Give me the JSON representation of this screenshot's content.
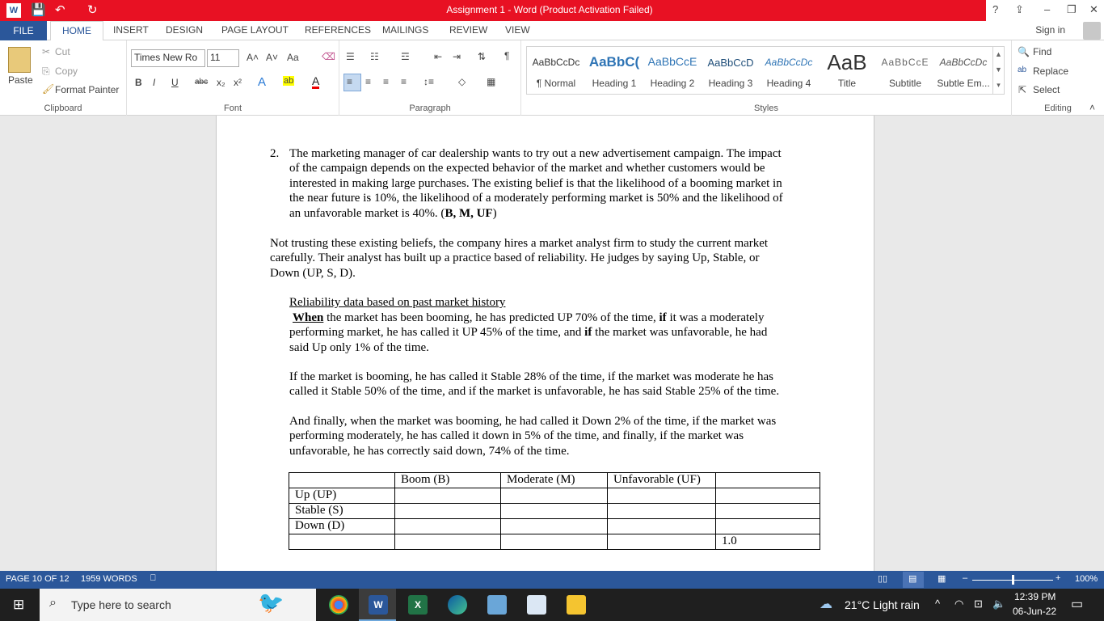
{
  "window": {
    "title": "Assignment 1  -  Word (Product Activation Failed)"
  },
  "title_controls": {
    "help": "?",
    "ribbon_options": "⇪",
    "minimize": "–",
    "restore": "❐",
    "close": "✕"
  },
  "tabs": {
    "file": "FILE",
    "items": [
      "HOME",
      "INSERT",
      "DESIGN",
      "PAGE LAYOUT",
      "REFERENCES",
      "MAILINGS",
      "REVIEW",
      "VIEW"
    ],
    "sign_in": "Sign in"
  },
  "ribbon": {
    "clipboard": {
      "paste": "Paste",
      "cut": "Cut",
      "copy": "Copy",
      "format_painter": "Format Painter",
      "label": "Clipboard"
    },
    "font": {
      "name": "Times New Ro",
      "size": "11",
      "grow": "A˄",
      "shrink": "A˅",
      "case": "Aa",
      "bold": "B",
      "italic": "I",
      "underline": "U",
      "strike": "abc",
      "subscript": "x₂",
      "superscript": "x²",
      "label": "Font"
    },
    "paragraph": {
      "label": "Paragraph"
    },
    "styles": {
      "items": [
        {
          "preview": "AaBbCcDc",
          "name": "¶ Normal"
        },
        {
          "preview": "AaBbC(",
          "name": "Heading 1"
        },
        {
          "preview": "AaBbCcE",
          "name": "Heading 2"
        },
        {
          "preview": "AaBbCcD",
          "name": "Heading 3"
        },
        {
          "preview": "AaBbCcDc",
          "name": "Heading 4"
        },
        {
          "preview": "AaB",
          "name": "Title"
        },
        {
          "preview": "AaBbCcE",
          "name": "Subtitle"
        },
        {
          "preview": "AaBbCcDc",
          "name": "Subtle Em..."
        }
      ],
      "label": "Styles"
    },
    "editing": {
      "find": "Find",
      "replace": "Replace",
      "select": "Select",
      "label": "Editing"
    }
  },
  "document": {
    "q2_number": "2.",
    "q2_lines": [
      "The marketing manager of car dealership wants to try out a new advertisement campaign.   The impact",
      "of the campaign depends on the expected behavior of the market and whether customers would be",
      "interested in making large purchases. The existing belief is that the likelihood of a booming market in",
      "the near future is 10%, the likelihood of a moderately performing market is 50% and the likelihood of",
      "an unfavorable market is 40%. ("
    ],
    "q2_bold_tail": "B, M, UF",
    "q2_close": ")",
    "trust_lines": [
      "Not trusting these existing beliefs, the company hires a market analyst firm to study the current market",
      "carefully. Their analyst has built up a practice based of reliability. He judges by saying Up, Stable, or",
      "Down (UP, S, D)."
    ],
    "reliability_heading": "Reliability data based on past market history",
    "up_when": "When",
    "up_line1_a": " the market has been booming, he has predicted UP 70% of the time, ",
    "up_if": "if",
    "up_line1_b": " it was a moderately",
    "up_line2_a": "performing market,  he has called it UP 45% of the time, and ",
    "up_if2": "if",
    "up_line2_b": " the market was unfavorable, he had",
    "up_line3": "said Up only 1% of the time.",
    "stable_lines": [
      "If the market is booming, he has called it Stable 28% of the time, if the market was moderate he has",
      "called it Stable 50% of the time, and if the market is unfavorable, he has said Stable 25% of the time."
    ],
    "down_lines": [
      "And finally, when the market was booming,  he had called it Down 2% of the time, if the market was",
      "performing moderately, he has called it down in 5% of the time, and finally, if the market was",
      "unfavorable, he has correctly said down, 74% of the time."
    ],
    "table": {
      "header": [
        "",
        "Boom (B)",
        "Moderate (M)",
        "Unfavorable (UF)",
        ""
      ],
      "rows": [
        [
          "Up (UP)",
          "",
          "",
          "",
          ""
        ],
        [
          "Stable (S)",
          "",
          "",
          "",
          ""
        ],
        [
          "Down (D)",
          "",
          "",
          "",
          ""
        ],
        [
          "",
          "",
          "",
          "",
          "1.0"
        ]
      ]
    }
  },
  "status_bar": {
    "page": "PAGE 10 OF 12",
    "words": "1959 WORDS",
    "zoom": "100%",
    "zoom_fraction": 0.5
  },
  "taskbar": {
    "search_placeholder": "Type here to search",
    "weather": "21°C  Light rain",
    "time": "12:39 PM",
    "date": "06-Jun-22"
  }
}
